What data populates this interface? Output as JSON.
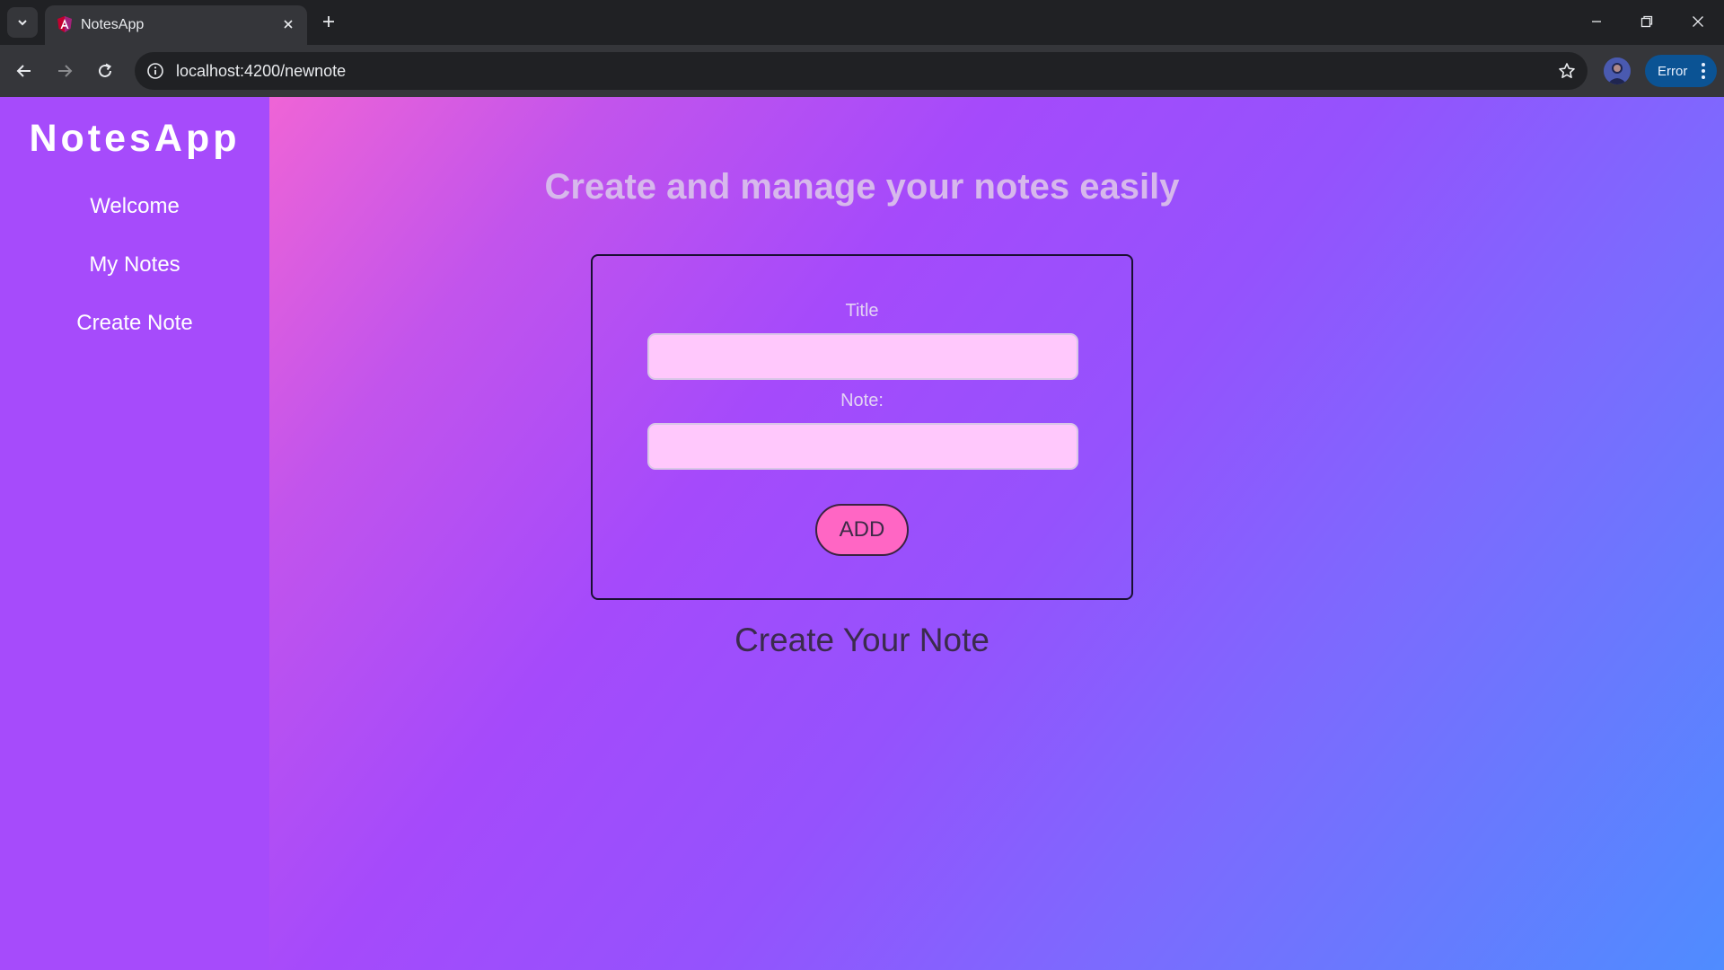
{
  "browser": {
    "tab_title": "NotesApp",
    "url": "localhost:4200/newnote",
    "profile_status": "Error"
  },
  "sidebar": {
    "brand": "NotesApp",
    "items": [
      {
        "label": "Welcome"
      },
      {
        "label": "My Notes"
      },
      {
        "label": "Create Note"
      }
    ]
  },
  "main": {
    "headline": "Create and manage your notes easily",
    "form": {
      "title_label": "Title",
      "title_value": "",
      "note_label": "Note:",
      "note_value": "",
      "add_label": "ADD"
    },
    "subheading": "Create Your Note"
  },
  "colors": {
    "sidebar_bg": "#a64bfb",
    "gradient_start": "#ef64d6",
    "gradient_end": "#4f8cff",
    "input_bg": "#ffc8fc",
    "add_button_bg": "#ff66c4"
  }
}
